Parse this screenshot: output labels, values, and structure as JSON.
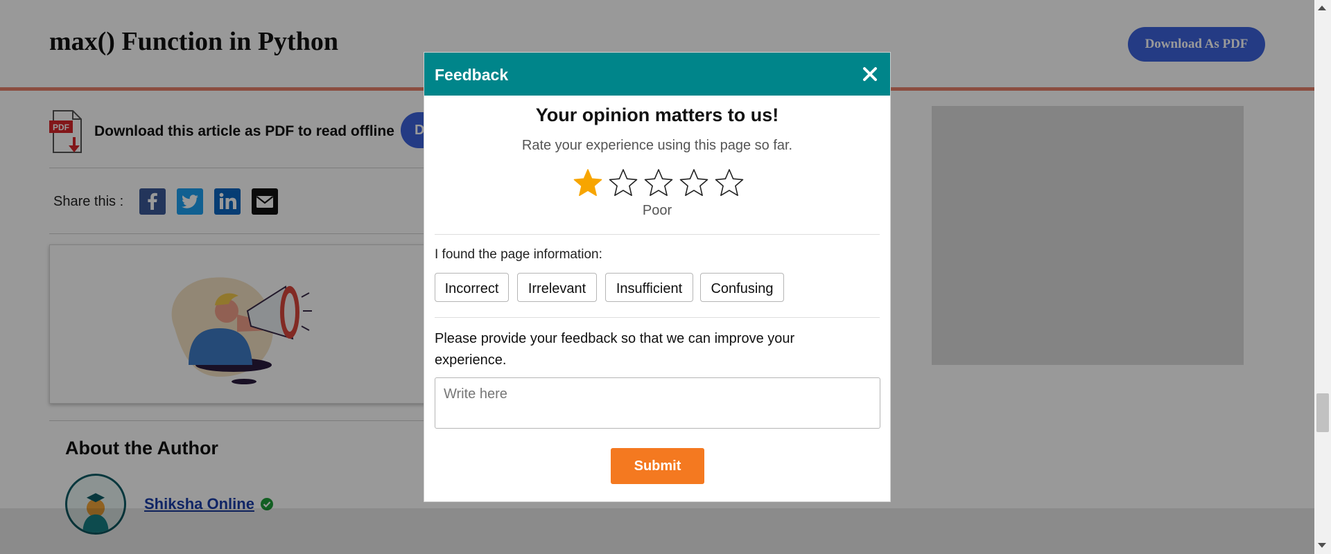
{
  "colors": {
    "header_rule": "#e8816c",
    "primary_blue": "#3d63dd",
    "modal_header": "#00858a",
    "submit": "#f47920",
    "star_filled": "#f7a500",
    "facebook": "#3b5998",
    "twitter": "#1da1f2",
    "linkedin": "#0a66c2",
    "email": "#111111"
  },
  "header": {
    "title": "max() Function in Python",
    "download_button": "Download As PDF"
  },
  "pdf_row": {
    "icon": "pdf-file-icon",
    "icon_label": "PDF",
    "text": "Download this article as PDF to read offline",
    "button_partial": "D"
  },
  "share": {
    "label": "Share this :",
    "icons": [
      "facebook-icon",
      "twitter-icon",
      "linkedin-icon",
      "email-icon"
    ]
  },
  "about": {
    "title": "About the Author",
    "author_name": "Shiksha Online"
  },
  "feedback_modal": {
    "title": "Feedback",
    "close_icon": "close-icon",
    "heading": "Your opinion matters to us!",
    "subheading": "Rate your experience using this page so far.",
    "rating": 1,
    "rating_max": 5,
    "rating_label": "Poor",
    "found_label": "I found the page information:",
    "options": [
      "Incorrect",
      "Irrelevant",
      "Insufficient",
      "Confusing"
    ],
    "feedback_prompt": "Please provide your feedback so that we can improve your experience.",
    "feedback_placeholder": "Write here",
    "submit_label": "Submit"
  }
}
